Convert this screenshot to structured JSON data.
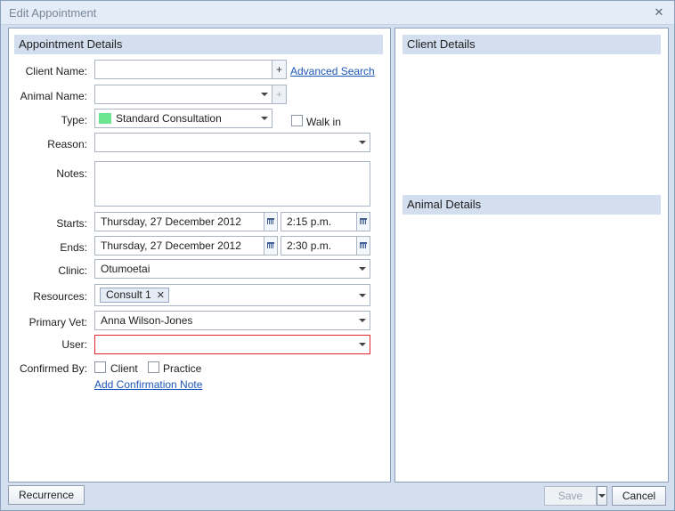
{
  "window": {
    "title": "Edit Appointment",
    "close_glyph": "✕"
  },
  "appointment": {
    "header": "Appointment Details",
    "client_name": {
      "label": "Client Name:",
      "value": "",
      "add_glyph": "+"
    },
    "advanced_search": "Advanced Search",
    "animal_name": {
      "label": "Animal Name:",
      "value": "",
      "add_glyph": "+"
    },
    "type": {
      "label": "Type:",
      "value": "Standard Consultation",
      "swatch_color": "#6be58f"
    },
    "walk_in": {
      "label": "Walk in",
      "checked": false
    },
    "reason": {
      "label": "Reason:",
      "value": ""
    },
    "notes": {
      "label": "Notes:",
      "value": ""
    },
    "starts": {
      "label": "Starts:",
      "date": "Thursday, 27 December 2012",
      "time": "2:15 p.m."
    },
    "ends": {
      "label": "Ends:",
      "date": "Thursday, 27 December 2012",
      "time": "2:30 p.m."
    },
    "clinic": {
      "label": "Clinic:",
      "value": "Otumoetai"
    },
    "resources": {
      "label": "Resources:",
      "tags": [
        "Consult 1"
      ],
      "remove_glyph": "✕"
    },
    "primary_vet": {
      "label": "Primary Vet:",
      "value": "Anna Wilson-Jones"
    },
    "user": {
      "label": "User:",
      "value": "",
      "error_color": "#e0262f"
    },
    "confirmed_by": {
      "label": "Confirmed By:",
      "client": "Client",
      "practice": "Practice"
    },
    "add_confirmation_note": "Add Confirmation Note"
  },
  "client_details": {
    "header": "Client Details"
  },
  "animal_details": {
    "header": "Animal Details"
  },
  "footer": {
    "recurrence": "Recurrence",
    "save": "Save",
    "cancel": "Cancel"
  }
}
